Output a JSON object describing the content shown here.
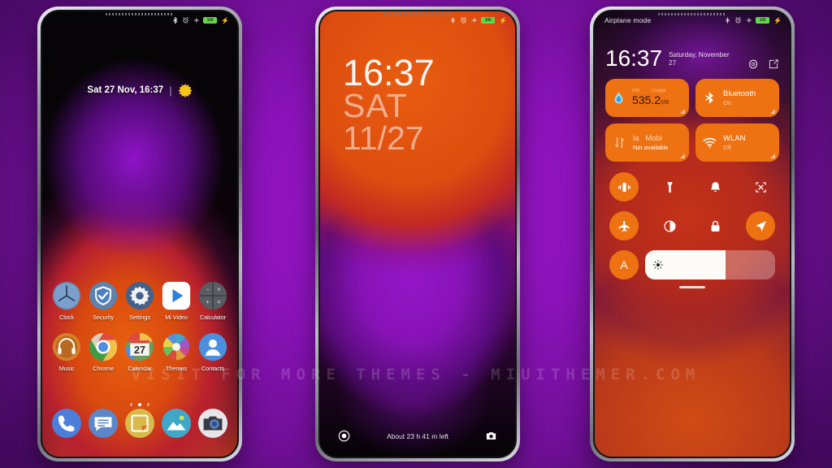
{
  "watermark": "VISIT  FOR  MORE  THEMES  -  MIUITHEMER.COM",
  "statusbar": {
    "icons": [
      "bluetooth-icon",
      "alarm-icon",
      "airplane-icon",
      "battery-icon"
    ],
    "battery_level": "100",
    "airplane_label": "Airplane mode"
  },
  "phone1": {
    "name": "home-screen",
    "clock_widget": {
      "text": "Sat 27 Nov, 16:37",
      "separator": "|",
      "weather_icon": "sun-icon"
    },
    "apps_row1": [
      {
        "label": "Clock",
        "icon": "clock-icon"
      },
      {
        "label": "Security",
        "icon": "shield-icon"
      },
      {
        "label": "Settings",
        "icon": "gear-icon"
      },
      {
        "label": "Mi Video",
        "icon": "play-icon"
      },
      {
        "label": "Calculator",
        "icon": "calculator-icon"
      }
    ],
    "apps_row2": [
      {
        "label": "Music",
        "icon": "headphones-icon"
      },
      {
        "label": "Chrome",
        "icon": "chrome-icon"
      },
      {
        "label": "Calendar",
        "icon": "calendar-icon",
        "day": "27"
      },
      {
        "label": "Themes",
        "icon": "color-wheel-icon"
      },
      {
        "label": "Contacts",
        "icon": "person-icon"
      }
    ],
    "page_dots": {
      "count": 3,
      "active_index": 1
    },
    "dock": [
      {
        "label": "Phone",
        "icon": "phone-icon"
      },
      {
        "label": "Messages",
        "icon": "message-icon"
      },
      {
        "label": "Notes",
        "icon": "notes-icon"
      },
      {
        "label": "Gallery",
        "icon": "gallery-icon"
      },
      {
        "label": "Camera",
        "icon": "camera-icon"
      }
    ]
  },
  "phone2": {
    "name": "lock-screen",
    "time": "16:37",
    "weekday": "SAT",
    "date": "11/27",
    "battery_hint": "About 23 h 41 m left",
    "left_icon": "flashlight-icon",
    "right_icon": "camera-icon"
  },
  "phone3": {
    "name": "control-center",
    "time": "16:37",
    "date": "Saturday, November 27",
    "header_icons": [
      "settings-gear-icon",
      "edit-icon"
    ],
    "tiles": [
      {
        "name": "data-usage-tile",
        "label_left": "mb",
        "label_right": "Usage",
        "value": "535.2",
        "unit": "MB",
        "icon": "data-drop-icon",
        "active": true
      },
      {
        "name": "bluetooth-tile",
        "title": "Bluetooth",
        "sub": "On",
        "icon": "bluetooth-icon",
        "active": true
      },
      {
        "name": "mobile-data-tile",
        "title": "Mobi",
        "label_left": "la",
        "sub": "Not available",
        "icon": "data-arrows-icon",
        "active": true
      },
      {
        "name": "wlan-tile",
        "title": "WLAN",
        "sub": "Off",
        "icon": "wifi-icon",
        "active": true
      }
    ],
    "toggles_row1": [
      {
        "name": "vibrate-toggle",
        "icon": "vibrate-icon",
        "active": true
      },
      {
        "name": "flashlight-toggle",
        "icon": "flashlight-icon",
        "active": false
      },
      {
        "name": "dnd-toggle",
        "icon": "bell-icon",
        "active": false
      },
      {
        "name": "screenshot-toggle",
        "icon": "screenshot-icon",
        "active": false
      }
    ],
    "toggles_row2": [
      {
        "name": "airplane-toggle",
        "icon": "airplane-icon",
        "active": true
      },
      {
        "name": "darkmode-toggle",
        "icon": "contrast-icon",
        "active": false
      },
      {
        "name": "lock-toggle",
        "icon": "lock-icon",
        "active": false
      },
      {
        "name": "location-toggle",
        "icon": "location-icon",
        "active": true
      }
    ],
    "brightness": {
      "auto_label": "A",
      "icon": "brightness-icon",
      "percent": 62
    }
  }
}
